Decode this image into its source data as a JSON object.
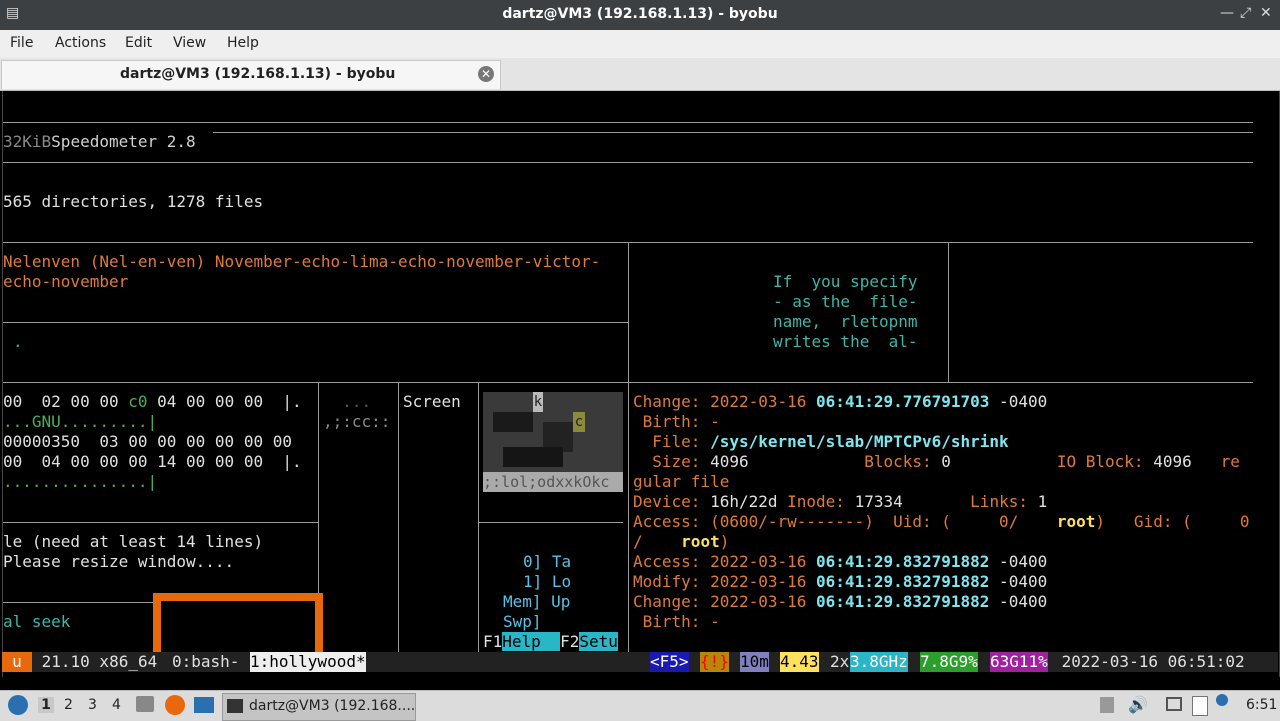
{
  "window": {
    "title": "dartz@VM3 (192.168.1.13) - byobu"
  },
  "menu": {
    "file": "File",
    "actions": "Actions",
    "edit": "Edit",
    "view": "View",
    "help": "Help"
  },
  "tab": {
    "label": "dartz@VM3 (192.168.1.13) - byobu"
  },
  "terminal": {
    "speedo_size": "32KiB",
    "speedo_label": "Speedometer 2.8",
    "dir_count": "565 directories, 1278 files",
    "nato_line1": "Nelenven (Nel-en-ven) November-echo-lima-echo-november-victor-",
    "nato_line2": "echo-november",
    "dot": ".",
    "man_text": [
      "If  you specify",
      "- as the  file-",
      "name,  rletopnm",
      "writes the  al-"
    ],
    "hex_lines": [
      "00  02 00 00 ",
      "c0",
      " 04 00 00 00  |.",
      "...GNU.........|",
      "00000350  03 00 00 00 00 00 00",
      "00  04 00 00 00 14 00 00 00  |.",
      "...............|"
    ],
    "small_dots1": "  ...",
    "small_dots2": ",;:cc::",
    "screen_label": "Screen",
    "ascii_art_bottom": ";:lol;odxxkOkc",
    "ascii_art_k": "k",
    "ascii_art_c": "c",
    "resize_msg1": "le (need at least 14 lines)",
    "resize_msg2": "Please resize window....",
    "seek_text": "al seek",
    "htop": [
      "0] Ta",
      "1] Lo",
      "Mem] Up",
      "Swp]"
    ],
    "fkeys": {
      "f1": "F1",
      "f1_label": "Help",
      "f2": "F2",
      "f2_label": "Setu"
    },
    "stat": {
      "change1_label": "Change: ",
      "change1_date": "2022-03-16 ",
      "change1_time": "06:41:29.776791703",
      "change1_tz": " -0400",
      "birth_label": " Birth: -",
      "file_label": "  File: ",
      "file_path": "/sys/kernel/slab/MPTCPv6/shrink",
      "size_label": "  Size: ",
      "size_value": "4096",
      "blocks_label": "Blocks: ",
      "blocks_value": "0",
      "ioblock_label": "IO Block: ",
      "ioblock_value": "4096",
      "re": "re",
      "gular": "gular file",
      "device_label": "Device: ",
      "device_value": "16h/22d",
      "inode_label": " Inode: ",
      "inode_value": "17334",
      "links_label": "Links: ",
      "links_value": "1",
      "access1_label": "Access: ",
      "access1_value": "(0600/-rw-------)",
      "uid_label": "  Uid: (     0/",
      "uid_user": "root",
      "gid_label": ")   Gid: (     0",
      "slash": "/",
      "gid_user": "root",
      "paren": ")",
      "access2_label": "Access: ",
      "access2_date": "2022-03-16 ",
      "access2_time": "06:41:29.832791882",
      "access2_tz": " -0400",
      "modify_label": "Modify: ",
      "modify_date": "2022-03-16 ",
      "modify_time": "06:41:29.832791882",
      "modify_tz": " -0400",
      "change2_label": "Change: ",
      "change2_date": "2022-03-16 ",
      "change2_time": "06:41:29.832791882",
      "change2_tz": " -0400",
      "birth2_label": " Birth: -"
    }
  },
  "status": {
    "logo": "u",
    "release": " 21.10 x86_64 ",
    "win0": "0:bash-",
    "win1": "1:hollywood*",
    "f5": "<F5>",
    "alert": "{!}",
    "uptime": "10m",
    "load": "4.43",
    "cpu_count": "2x",
    "cpu_freq": "3.8GHz",
    "mem": "7.8G9%",
    "disk": "63G11%",
    "datetime": " 2022-03-16 06:51:02"
  },
  "taskbar": {
    "workspaces": [
      "1",
      "2",
      "3",
      "4"
    ],
    "task_label": "dartz@VM3 (192.168....",
    "clock": "6:51"
  },
  "colors": {
    "accent_orange": "#e8680c",
    "cyan_highlight": "#29b6c6"
  }
}
